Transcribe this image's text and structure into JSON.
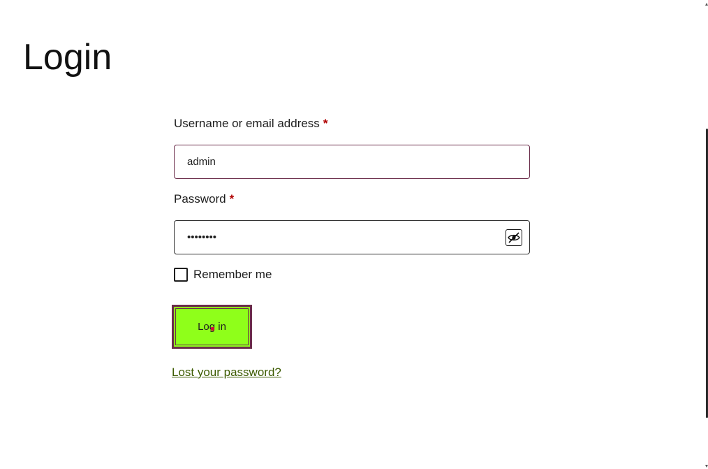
{
  "page": {
    "title": "Login"
  },
  "form": {
    "username": {
      "label": "Username or email address",
      "required_mark": "*",
      "value": "admin"
    },
    "password": {
      "label": "Password",
      "required_mark": "*",
      "value": "••••••••",
      "toggle_icon": "eye-slash-icon"
    },
    "remember": {
      "label": "Remember me",
      "checked": false
    },
    "submit_label": "Log in",
    "lost_password_label": "Lost your password?"
  },
  "colors": {
    "button_bg": "#8fff1a",
    "button_border": "#6b2d4a",
    "link": "#3c5b00",
    "required": "#b00000"
  }
}
